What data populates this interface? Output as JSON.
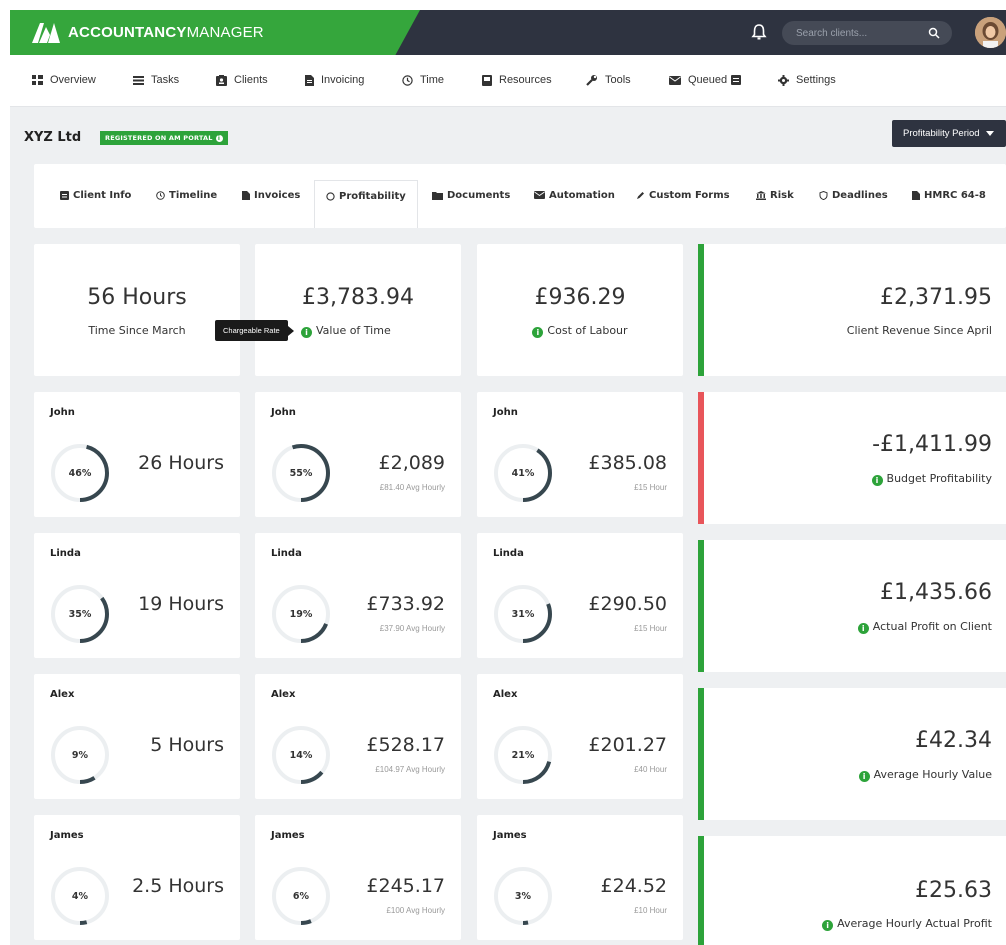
{
  "app": {
    "brand_bold": "ACCOUNTANCY",
    "brand_rest": "MANAGER"
  },
  "search": {
    "placeholder": "Search clients..."
  },
  "nav": [
    {
      "label": "Overview",
      "icon": "overview-icon"
    },
    {
      "label": "Tasks",
      "icon": "tasks-icon"
    },
    {
      "label": "Clients",
      "icon": "clients-icon"
    },
    {
      "label": "Invoicing",
      "icon": "invoicing-icon"
    },
    {
      "label": "Time",
      "icon": "clock-icon"
    },
    {
      "label": "Resources",
      "icon": "resources-icon"
    },
    {
      "label": "Tools",
      "icon": "wrench-icon"
    },
    {
      "label": "Queued",
      "icon": "mail-icon"
    },
    {
      "label": "Settings",
      "icon": "gear-icon"
    }
  ],
  "client": {
    "name": "XYZ Ltd",
    "badge": "REGISTERED ON AM PORTAL"
  },
  "period_button": "Profitability Period",
  "tabs": [
    {
      "label": "Client Info"
    },
    {
      "label": "Timeline"
    },
    {
      "label": "Invoices"
    },
    {
      "label": "Profitability",
      "active": true
    },
    {
      "label": "Documents"
    },
    {
      "label": "Automation"
    },
    {
      "label": "Custom Forms"
    },
    {
      "label": "Risk"
    },
    {
      "label": "Deadlines"
    },
    {
      "label": "HMRC 64-8"
    }
  ],
  "top_cards": [
    {
      "value": "56 Hours",
      "label": "Time Since March"
    },
    {
      "value": "£3,783.94",
      "label": "Value of Time"
    },
    {
      "value": "£936.29",
      "label": "Cost of Labour"
    }
  ],
  "tooltip": "Chargeable Rate",
  "people": [
    {
      "name": "John",
      "hours_pct": "46%",
      "hours_frac": 0.46,
      "hours": "26 Hours",
      "value_pct": "55%",
      "value_frac": 0.55,
      "value": "£2,089",
      "value_sub": "£81.40 Avg Hourly",
      "cost_pct": "41%",
      "cost_frac": 0.41,
      "cost": "£385.08",
      "cost_sub": "£15 Hour"
    },
    {
      "name": "Linda",
      "hours_pct": "35%",
      "hours_frac": 0.35,
      "hours": "19 Hours",
      "value_pct": "19%",
      "value_frac": 0.19,
      "value": "£733.92",
      "value_sub": "£37.90 Avg Hourly",
      "cost_pct": "31%",
      "cost_frac": 0.31,
      "cost": "£290.50",
      "cost_sub": "£15 Hour"
    },
    {
      "name": "Alex",
      "hours_pct": "9%",
      "hours_frac": 0.09,
      "hours": "5 Hours",
      "value_pct": "14%",
      "value_frac": 0.14,
      "value": "£528.17",
      "value_sub": "£104.97 Avg Hourly",
      "cost_pct": "21%",
      "cost_frac": 0.21,
      "cost": "£201.27",
      "cost_sub": "£40 Hour"
    },
    {
      "name": "James",
      "hours_pct": "4%",
      "hours_frac": 0.04,
      "hours": "2.5 Hours",
      "value_pct": "6%",
      "value_frac": 0.06,
      "value": "£245.17",
      "value_sub": "£100 Avg Hourly",
      "cost_pct": "3%",
      "cost_frac": 0.03,
      "cost": "£24.52",
      "cost_sub": "£10 Hour"
    }
  ],
  "summary": [
    {
      "value": "£2,371.95",
      "label": "Client Revenue Since April",
      "info": false,
      "color": "#2da33a"
    },
    {
      "value": "-£1,411.99",
      "label": "Budget Profitability",
      "info": true,
      "color": "#e8555a"
    },
    {
      "value": "£1,435.66",
      "label": "Actual Profit on Client",
      "info": true,
      "color": "#2da33a"
    },
    {
      "value": "£42.34",
      "label": "Average Hourly Value",
      "info": true,
      "color": "#2da33a"
    },
    {
      "value": "£25.63",
      "label": "Average Hourly Actual Profit",
      "info": true,
      "color": "#2da33a"
    }
  ],
  "colors": {
    "brand_green": "#35a63c",
    "dark": "#2e3340",
    "ring": "#37474f",
    "ring_track": "#eceff1",
    "danger": "#e8555a"
  }
}
